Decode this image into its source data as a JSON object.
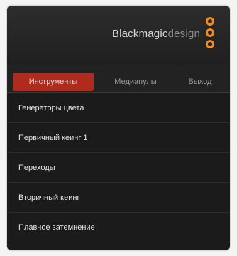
{
  "brand": {
    "name_main": "Blackmagic",
    "name_dim": "design"
  },
  "tabs": [
    {
      "label": "Инструменты",
      "active": true
    },
    {
      "label": "Медиапулы",
      "active": false
    },
    {
      "label": "Выход",
      "active": false
    }
  ],
  "tools_menu": {
    "items": [
      {
        "label": "Генераторы цвета"
      },
      {
        "label": "Первичный кеинг 1"
      },
      {
        "label": "Переходы"
      },
      {
        "label": "Вторичный кеинг"
      },
      {
        "label": "Плавное затемнение"
      }
    ]
  },
  "colors": {
    "accent": "#b02a1e",
    "logo": "#f08a1a",
    "background": "#222222"
  }
}
